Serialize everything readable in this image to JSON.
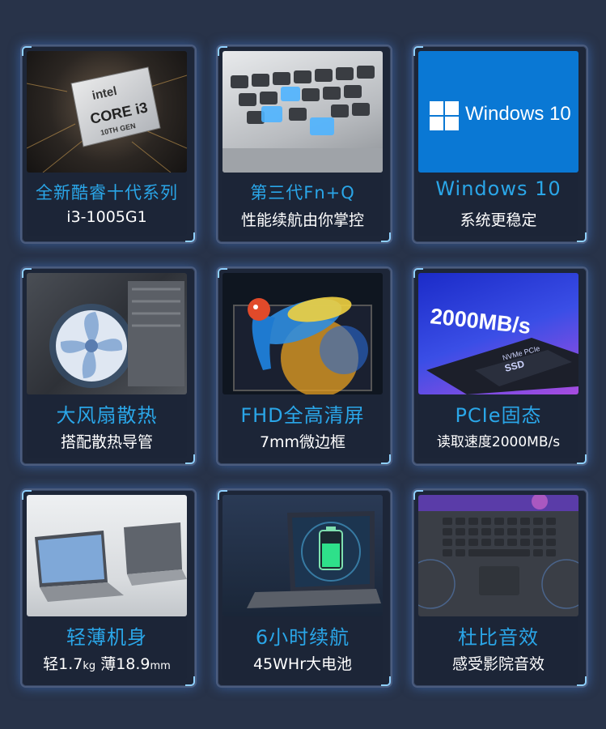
{
  "cards": [
    {
      "title": "全新酷睿十代系列",
      "subtitle": "i3-1005G1",
      "badge": [
        "intel",
        "CORE i3",
        "10TH GEN"
      ]
    },
    {
      "title": "第三代Fn+Q",
      "subtitle": "性能续航由你掌控"
    },
    {
      "title": "Windows 10",
      "subtitle": "系统更稳定",
      "logo_text": "Windows 10"
    },
    {
      "title": "大风扇散热",
      "subtitle": "搭配散热导管"
    },
    {
      "title": "FHD全高清屏",
      "subtitle": "7mm微边框"
    },
    {
      "title": "PCIe固态",
      "subtitle": "读取速度2000MB/s",
      "image_text": [
        "2000MB/s",
        "NVMe PCIe",
        "SSD"
      ]
    },
    {
      "title": "轻薄机身",
      "subtitle_parts": [
        "轻1.7",
        "kg",
        " 薄18.9",
        "mm"
      ]
    },
    {
      "title": "6小时续航",
      "subtitle": "45WHr大电池"
    },
    {
      "title": "杜比音效",
      "subtitle": "感受影院音效"
    }
  ],
  "colors": {
    "background": "#283349",
    "accent": "#2aa6e8",
    "text": "#ffffff"
  }
}
